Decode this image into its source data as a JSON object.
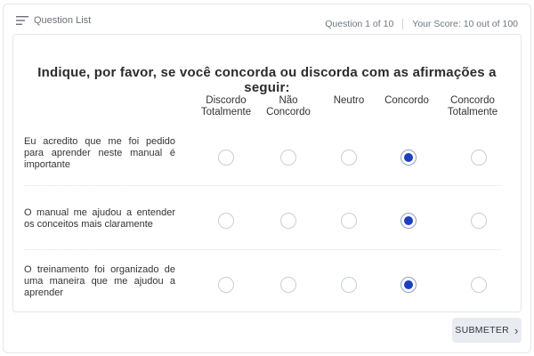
{
  "topbar": {
    "question_list_label": "Question List",
    "progress": "Question 1 of 10",
    "score": "Your Score: 10 out of 100"
  },
  "survey": {
    "question": "Indique, por favor, se você concorda ou discorda com as afirmações a seguir:",
    "columns": [
      "Discordo\nTotalmente",
      "Não\nConcordo",
      "Neutro",
      "Concordo",
      "Concordo\nTotalmente"
    ],
    "rows": [
      {
        "statement": "Eu acredito que me foi pedido para aprender neste manual é importante",
        "selected": "Concordo"
      },
      {
        "statement": "O manual me ajudou a entender os conceitos mais claramente",
        "selected": "Concordo"
      },
      {
        "statement": "O treinamento foi organizado de uma maneira que me ajudou a aprender",
        "selected": "Concordo"
      }
    ]
  },
  "actions": {
    "submit_label": "SUBMETER"
  },
  "colors": {
    "accent": "#1c3fc0",
    "button_bg": "#e8ebf0"
  },
  "icons": {
    "question_list": "list-icon",
    "submit": "chevron-right-icon"
  }
}
